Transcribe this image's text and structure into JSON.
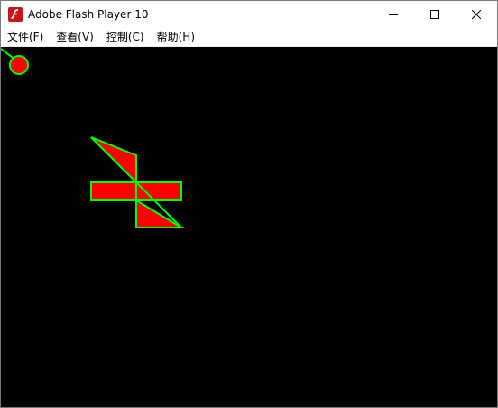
{
  "window": {
    "title": "Adobe Flash Player 10",
    "icon": "flash-player-icon",
    "controls": [
      "minimize-icon",
      "maximize-icon",
      "close-icon"
    ]
  },
  "menu": {
    "items": [
      {
        "label": "文件(F)"
      },
      {
        "label": "查看(V)"
      },
      {
        "label": "控制(C)"
      },
      {
        "label": "帮助(H)"
      }
    ]
  },
  "stage": {
    "background": "#000000",
    "shape_fill": "#ff0000",
    "shape_stroke": "#00ff00"
  }
}
